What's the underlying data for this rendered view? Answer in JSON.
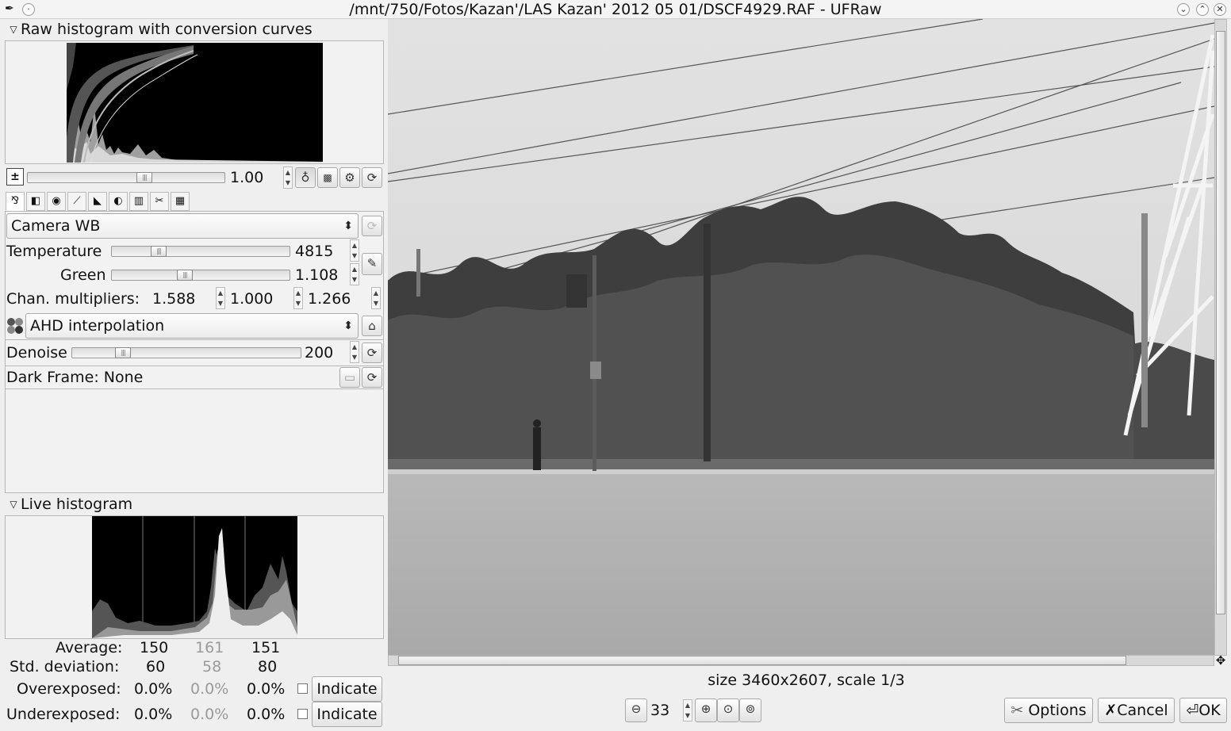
{
  "window": {
    "title": "/mnt/750/Fotos/Kazan'/LAS  Kazan'  2012  05  01/DSCF4929.RAF - UFRaw"
  },
  "raw_histogram": {
    "title": "Raw histogram with conversion curves",
    "exposure_value": "1.00"
  },
  "white_balance": {
    "preset": "Camera WB",
    "temperature_label": "Temperature",
    "temperature_value": "4815",
    "temperature_level": 0.24,
    "green_label": "Green",
    "green_value": "1.108",
    "green_level": 0.4,
    "chan_label": "Chan. multipliers:",
    "chan_r": "1.588",
    "chan_g": "1.000",
    "chan_b": "1.266"
  },
  "interpolation": {
    "selected": "AHD interpolation"
  },
  "denoise": {
    "label": "Denoise",
    "value": "200",
    "level": 0.2
  },
  "dark_frame": {
    "label": "Dark Frame: None"
  },
  "exposure_level": 0.6,
  "live_histogram": {
    "title": "Live histogram",
    "average_label": "Average:",
    "average": [
      "150",
      "161",
      "151"
    ],
    "std_label": "Std. deviation:",
    "std": [
      "60",
      "58",
      "80"
    ],
    "over_label": "Overexposed:",
    "over": [
      "0.0%",
      "0.0%",
      "0.0%"
    ],
    "under_label": "Underexposed:",
    "under": [
      "0.0%",
      "0.0%",
      "0.0%"
    ],
    "indicate_label": "Indicate"
  },
  "preview": {
    "size_text": "size 3460x2607, scale 1/3",
    "zoom_value": "33"
  },
  "buttons": {
    "options": "Options",
    "cancel": "Cancel",
    "ok": "OK"
  },
  "icons": [
    "menu-icon",
    "minimize-icon",
    "maximize-icon",
    "close-icon",
    "exposure-icon",
    "auto-exposure-icon",
    "clip-icon",
    "gear-icon",
    "reset-icon",
    "eyedropper-icon",
    "bayer-icon",
    "brush-icon",
    "folder-icon",
    "zoom-out-icon",
    "zoom-in-icon",
    "zoom-fit-icon",
    "zoom-100-icon"
  ]
}
